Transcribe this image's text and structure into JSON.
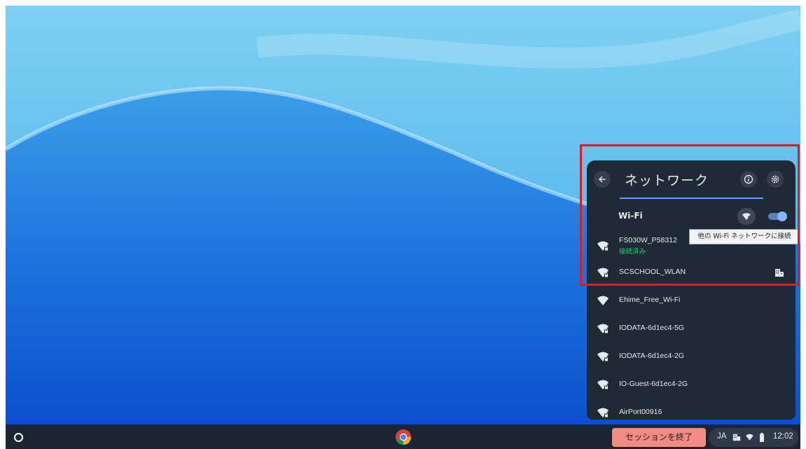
{
  "panel": {
    "title": "ネットワーク",
    "wifi_label": "Wi-Fi",
    "wifi_enabled": true,
    "tooltip": "他の Wi-Fi ネットワークに接続",
    "networks": [
      {
        "name": "FS030W_P58312",
        "status": "接続済み",
        "icon": "wifi-secured-icon"
      },
      {
        "name": "SCSCHOOL_WLAN",
        "icon": "wifi-secured-icon",
        "managed_icon": "enterprise-icon"
      },
      {
        "name": "Ehime_Free_Wi-Fi",
        "icon": "wifi-icon"
      },
      {
        "name": "IODATA-6d1ec4-5G",
        "icon": "wifi-secured-icon"
      },
      {
        "name": "IODATA-6d1ec4-2G",
        "icon": "wifi-secured-icon"
      },
      {
        "name": "IO-Guest-6d1ec4-2G",
        "icon": "wifi-secured-icon"
      },
      {
        "name": "AirPort00916",
        "icon": "wifi-secured-icon"
      }
    ]
  },
  "shelf": {
    "end_session_label": "セッションを終了",
    "ime": "JA",
    "clock": "12:02"
  },
  "colors": {
    "panel_bg": "#1f2a37",
    "accent": "#8ab4f8",
    "connected_green": "#2ecc71",
    "end_session_bg": "#f28b82",
    "highlight_red": "#e8161d"
  }
}
